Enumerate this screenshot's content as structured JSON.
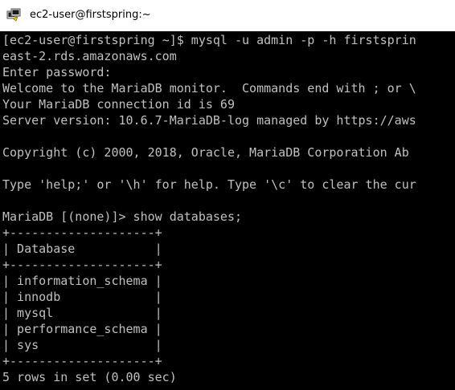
{
  "window": {
    "title": "ec2-user@firstspring:~",
    "icon": "putty-terminal-icon"
  },
  "terminal": {
    "background": "#000000",
    "foreground": "#c0c0c0",
    "lines": [
      "[ec2-user@firstspring ~]$ mysql -u admin -p -h firstsprin",
      "east-2.rds.amazonaws.com",
      "Enter password:",
      "Welcome to the MariaDB monitor.  Commands end with ; or \\",
      "Your MariaDB connection id is 69",
      "Server version: 10.6.7-MariaDB-log managed by https://aws",
      "",
      "Copyright (c) 2000, 2018, Oracle, MariaDB Corporation Ab",
      "",
      "Type 'help;' or '\\h' for help. Type '\\c' to clear the cur",
      "",
      "MariaDB [(none)]> show databases;",
      "+--------------------+",
      "| Database           |",
      "+--------------------+",
      "| information_schema |",
      "| innodb             |",
      "| mysql              |",
      "| performance_schema |",
      "| sys                |",
      "+--------------------+",
      "5 rows in set (0.00 sec)"
    ]
  }
}
